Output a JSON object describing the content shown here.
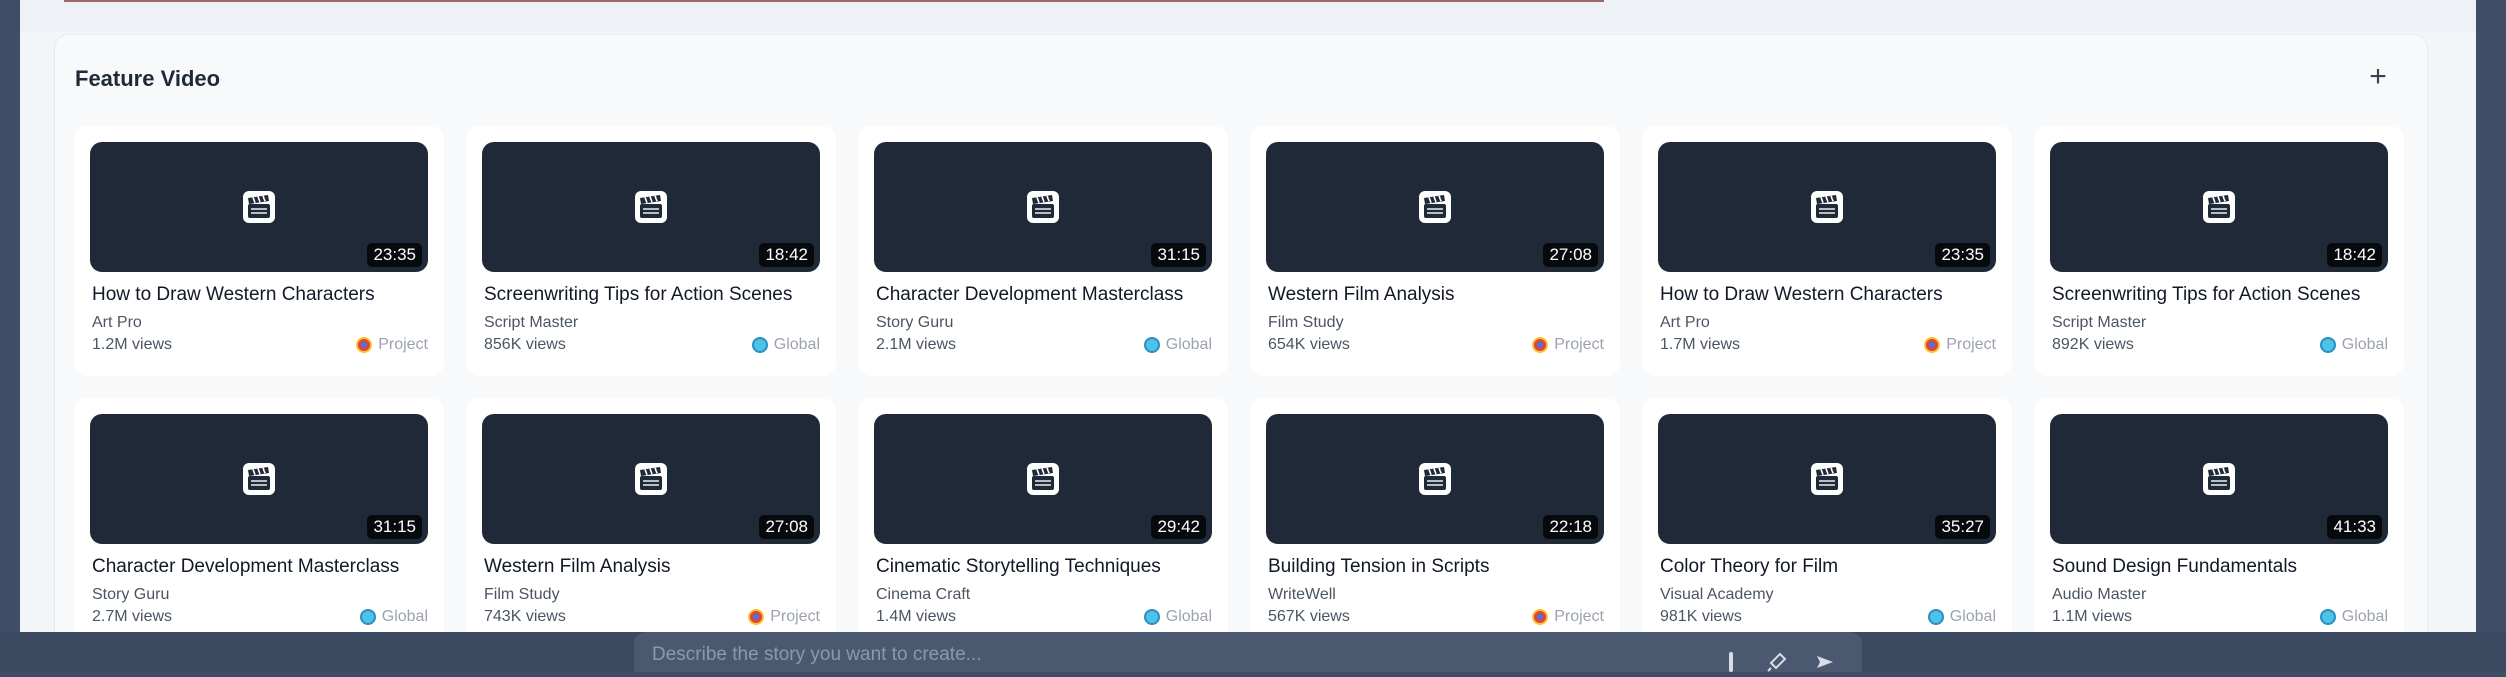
{
  "section": {
    "title": "Feature Video",
    "add_label": "+"
  },
  "videos": [
    {
      "title": "How to Draw Western Characters",
      "channel": "Art Pro",
      "views": "1.2M views",
      "duration": "23:35",
      "scope": "Project"
    },
    {
      "title": "Screenwriting Tips for Action Scenes",
      "channel": "Script Master",
      "views": "856K views",
      "duration": "18:42",
      "scope": "Global"
    },
    {
      "title": "Character Development Masterclass",
      "channel": "Story Guru",
      "views": "2.1M views",
      "duration": "31:15",
      "scope": "Global"
    },
    {
      "title": "Western Film Analysis",
      "channel": "Film Study",
      "views": "654K views",
      "duration": "27:08",
      "scope": "Project"
    },
    {
      "title": "How to Draw Western Characters",
      "channel": "Art Pro",
      "views": "1.7M views",
      "duration": "23:35",
      "scope": "Project"
    },
    {
      "title": "Screenwriting Tips for Action Scenes",
      "channel": "Script Master",
      "views": "892K views",
      "duration": "18:42",
      "scope": "Global"
    },
    {
      "title": "Character Development Masterclass",
      "channel": "Story Guru",
      "views": "2.7M views",
      "duration": "31:15",
      "scope": "Global"
    },
    {
      "title": "Western Film Analysis",
      "channel": "Film Study",
      "views": "743K views",
      "duration": "27:08",
      "scope": "Project"
    },
    {
      "title": "Cinematic Storytelling Techniques",
      "channel": "Cinema Craft",
      "views": "1.4M views",
      "duration": "29:42",
      "scope": "Global"
    },
    {
      "title": "Building Tension in Scripts",
      "channel": "WriteWell",
      "views": "567K views",
      "duration": "22:18",
      "scope": "Project"
    },
    {
      "title": "Color Theory for Film",
      "channel": "Visual Academy",
      "views": "981K views",
      "duration": "35:27",
      "scope": "Global"
    },
    {
      "title": "Sound Design Fundamentals",
      "channel": "Audio Master",
      "views": "1.1M views",
      "duration": "41:33",
      "scope": "Global"
    }
  ],
  "prompt": {
    "placeholder": "Describe the story you want to create..."
  },
  "icons": {
    "thumbnail": "clapperboard-icon",
    "project_scope": "project-icon",
    "global_scope": "globe-icon",
    "prompt_actions": [
      "brush-icon",
      "microphone-icon",
      "send-icon"
    ]
  },
  "colors": {
    "thumbnail_bg": "#1f2937",
    "page_frame": "#3f4e66",
    "global_dot": "#4cc3e8",
    "project_dot": "#e0443e"
  }
}
